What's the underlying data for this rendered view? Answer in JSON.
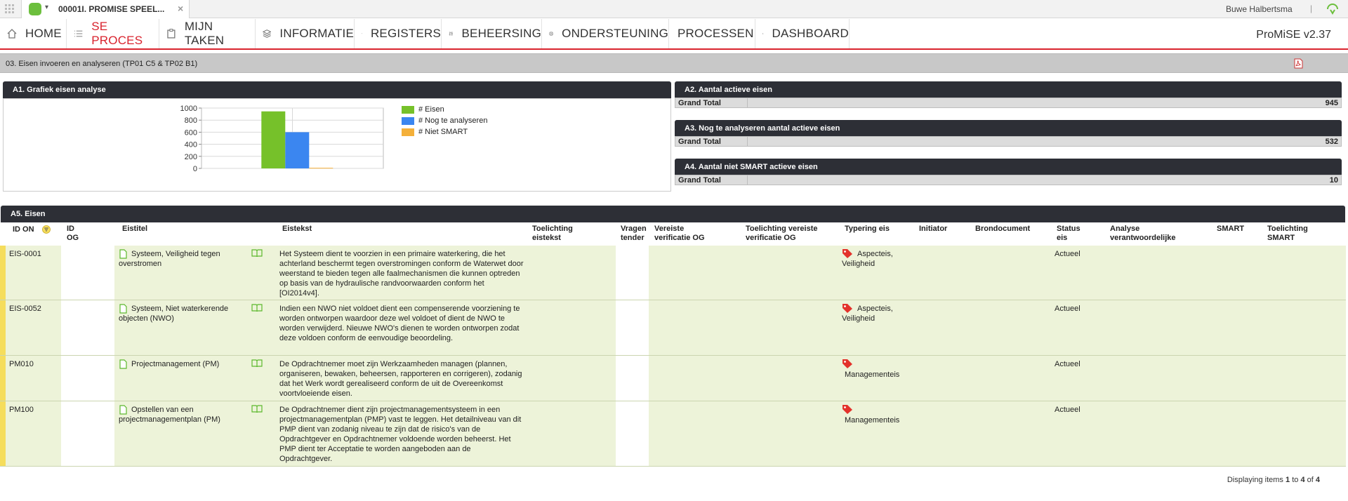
{
  "topbar": {
    "app_title": "00001I. PROMISE SPEEL...",
    "user_name": "Buwe Halbertsma",
    "separator": "|"
  },
  "nav": {
    "items": [
      {
        "label": "HOME",
        "icon": "home-icon"
      },
      {
        "label": "SE PROCES",
        "icon": "list-icon"
      },
      {
        "label": "MIJN TAKEN",
        "icon": "clipboard-icon"
      },
      {
        "label": "INFORMATIE",
        "icon": "layers-icon"
      },
      {
        "label": "REGISTERS",
        "icon": "register-icon"
      },
      {
        "label": "BEHEERSING",
        "icon": "sliders-icon"
      },
      {
        "label": "ONDERSTEUNING",
        "icon": "lifebuoy-icon"
      },
      {
        "label": "PROCESSEN",
        "icon": ""
      },
      {
        "label": "DASHBOARD",
        "icon": "bar-chart-icon"
      }
    ],
    "active": "SE PROCES",
    "brand": "ProMiSE v2.37"
  },
  "section": {
    "title": "03. Eisen invoeren en analyseren (TP01 C5 & TP02 B1)"
  },
  "panels": {
    "a1_title": "A1. Grafiek eisen analyse",
    "a2_title": "A2. Aantal actieve eisen",
    "a2_label": "Grand Total",
    "a2_value": "945",
    "a3_title": "A3. Nog te analyseren aantal actieve eisen",
    "a3_label": "Grand Total",
    "a3_value": "532",
    "a4_title": "A4. Aantal niet SMART actieve eisen",
    "a4_label": "Grand Total",
    "a4_value": "10",
    "a5_title": "A5. Eisen"
  },
  "chart_data": {
    "type": "bar",
    "categories": [
      ""
    ],
    "series": [
      {
        "name": "# Eisen",
        "values": [
          945
        ],
        "color": "#76c12a"
      },
      {
        "name": "# Nog te analyseren",
        "values": [
          600
        ],
        "color": "#3b86f0"
      },
      {
        "name": "# Niet SMART",
        "values": [
          10
        ],
        "color": "#f4b03a"
      }
    ],
    "yticks": [
      "1000",
      "800",
      "600",
      "400",
      "200",
      "0"
    ],
    "ylim": [
      0,
      1000
    ],
    "grid": true,
    "legend_position": "right"
  },
  "table": {
    "columns": {
      "id_on": "ID ON",
      "id_og": "ID OG",
      "eistitel": "Eistitel",
      "eistekst": "Eistekst",
      "toelichting_eistekst": "Toelichting eistekst",
      "vragen_tender": "Vragen tender",
      "vereiste_verificatie": "Vereiste verificatie OG",
      "toelichting_verificatie": "Toelichting vereiste verificatie OG",
      "typering": "Typering eis",
      "initiator": "Initiator",
      "brondocument": "Brondocument",
      "status": "Status eis",
      "analyse": "Analyse verantwoordelijke",
      "smart": "SMART",
      "toelichting_smart": "Toelichting SMART"
    },
    "rows": [
      {
        "id": "EIS-0001",
        "title": "Systeem, Veiligheid tegen overstromen",
        "text": "Het Systeem dient te voorzien in een primaire waterkering, die het achterland beschermt tegen overstromingen conform de Waterwet door weerstand te bieden tegen alle faalmechanismen die kunnen optreden op basis van de hydraulische randvoorwaarden conform het [OI2014v4].",
        "typering": "Aspecteis, Veiligheid",
        "status": "Actueel"
      },
      {
        "id": "EIS-0052",
        "title": "Systeem, Niet waterkerende objecten (NWO)",
        "text": "Indien een NWO niet voldoet dient een compenserende voorziening te worden ontworpen waardoor deze wel voldoet of dient de NWO te worden verwijderd. Nieuwe NWO's dienen te worden ontworpen zodat deze voldoen conform de eenvoudige beoordeling.",
        "typering": "Aspecteis, Veiligheid",
        "status": "Actueel"
      },
      {
        "id": "PM010",
        "title": "Projectmanagement (PM)",
        "text": "De Opdrachtnemer moet zijn Werkzaamheden managen (plannen, organiseren, bewaken, beheersen, rapporteren en corrigeren), zodanig dat het Werk wordt gerealiseerd conform de uit de Overeenkomst voortvloeiende eisen.",
        "typering": "Managementeis",
        "status": "Actueel"
      },
      {
        "id": "PM100",
        "title": "Opstellen van een projectmanagementplan (PM)",
        "text": "De Opdrachtnemer dient zijn projectmanagementsysteem in een projectmanagementplan (PMP) vast te leggen. Het detailniveau van dit PMP dient van zodanig niveau te zijn dat de risico's van de Opdrachtgever en Opdrachtnemer voldoende worden beheerst. Het PMP dient ter Acceptatie te worden aangeboden aan de Opdrachtgever.",
        "typering": "Managementeis",
        "status": "Actueel"
      }
    ]
  },
  "footer": {
    "prefix": "Displaying items",
    "from": "1",
    "to_word": "to",
    "to": "4",
    "of_word": "of",
    "total": "4"
  }
}
